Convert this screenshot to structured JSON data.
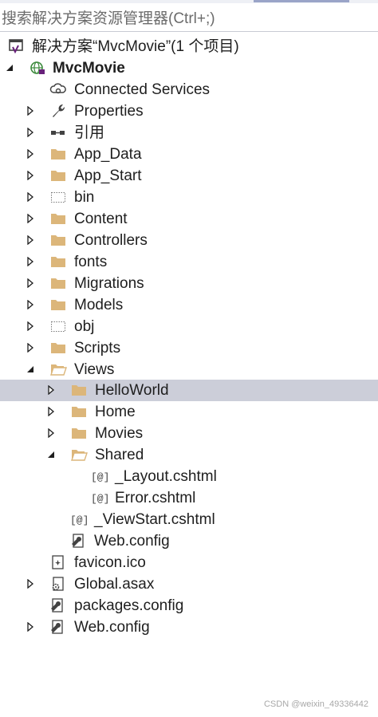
{
  "search": {
    "placeholder": "搜索解决方案资源管理器(Ctrl+;)"
  },
  "tree": {
    "solution": "解决方案“MvcMovie”(1 个项目)",
    "project": "MvcMovie",
    "connected_services": "Connected Services",
    "properties": "Properties",
    "references": "引用",
    "app_data": "App_Data",
    "app_start": "App_Start",
    "bin": "bin",
    "content": "Content",
    "controllers": "Controllers",
    "fonts": "fonts",
    "migrations": "Migrations",
    "models": "Models",
    "obj": "obj",
    "scripts": "Scripts",
    "views": "Views",
    "helloworld": "HelloWorld",
    "home": "Home",
    "movies": "Movies",
    "shared": "Shared",
    "layout": "_Layout.cshtml",
    "error": "Error.cshtml",
    "viewstart": "_ViewStart.cshtml",
    "views_webconfig": "Web.config",
    "favicon": "favicon.ico",
    "global": "Global.asax",
    "packages": "packages.config",
    "webconfig": "Web.config"
  },
  "icons": {
    "folder_color": "#dcb67a",
    "selection_color": "#ccced9",
    "project_color": "#3c8a3c",
    "vs_color": "#68217a"
  },
  "footer": {
    "watermark": "CSDN @weixin_49336442"
  }
}
